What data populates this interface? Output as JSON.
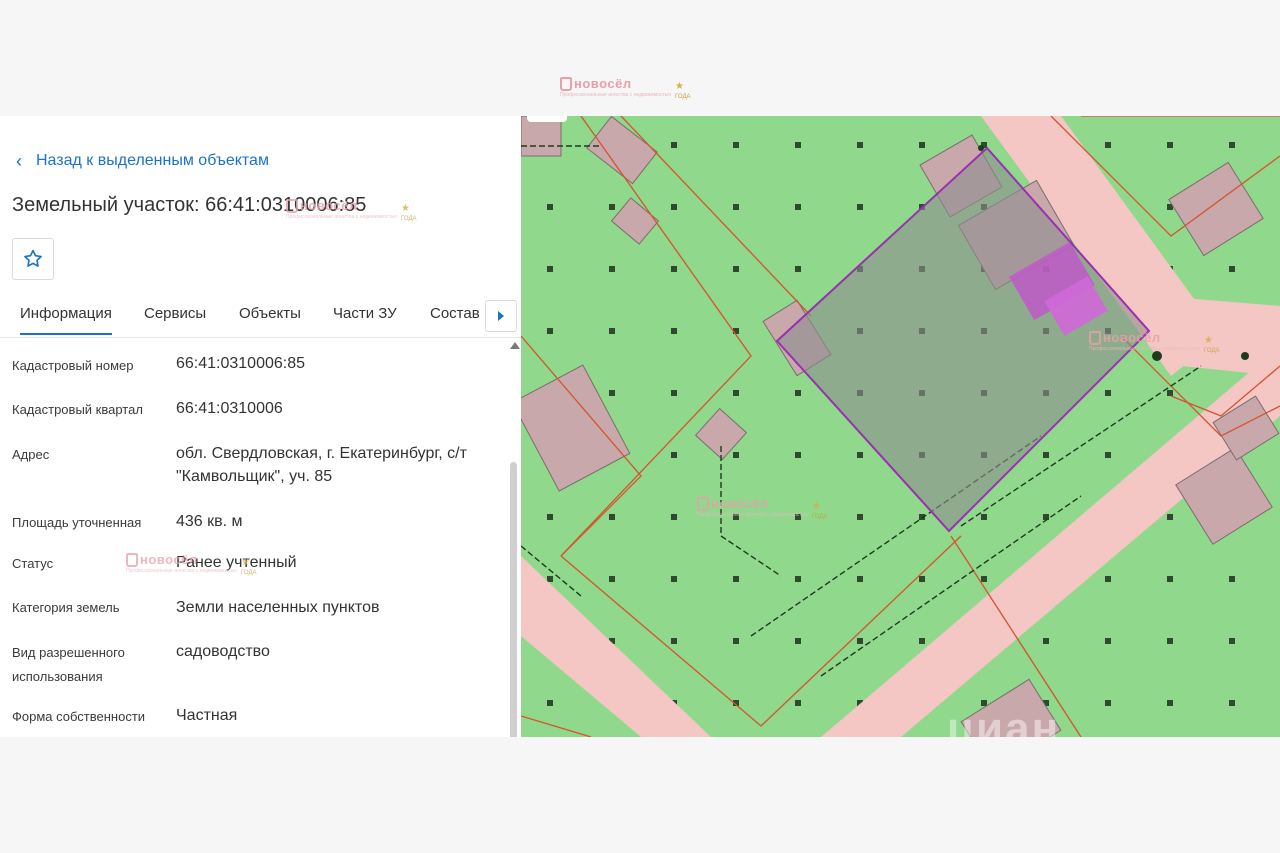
{
  "watermark": {
    "brand": "новосёл",
    "tagline": "Профессиональные агенства с недвижимостью",
    "years": "ГОДА"
  },
  "back_link": {
    "label": "Назад к выделенным объектам"
  },
  "title": "Земельный участок: 66:41:0310006:85",
  "tabs": [
    {
      "label": "Информация",
      "active": true
    },
    {
      "label": "Сервисы"
    },
    {
      "label": "Объекты"
    },
    {
      "label": "Части ЗУ"
    },
    {
      "label": "Состав"
    }
  ],
  "info": [
    {
      "label": "Кадастровый номер",
      "value": "66:41:0310006:85"
    },
    {
      "label": "Кадастровый квартал",
      "value": "66:41:0310006"
    },
    {
      "label": "Адрес",
      "value": "обл. Свердловская, г. Екатеринбург, с/т \"Камвольщик\", уч. 85"
    },
    {
      "label": "Площадь уточненная",
      "value": "436 кв. м"
    },
    {
      "label": "Статус",
      "value": "Ранее учтенный"
    },
    {
      "label": "Категория земель",
      "value": "Земли населенных пунктов"
    },
    {
      "label": "Вид разрешенного использования",
      "value": "садоводство"
    },
    {
      "label": "Форма собственности",
      "value": "Частная"
    }
  ],
  "map": {
    "watermark": "циан"
  },
  "colors": {
    "accent": "#1a73c8",
    "map_green": "#8fd88c",
    "road": "#f4c6c4",
    "parcel_outline": "#9a2fb0",
    "building": "#c9a8ac"
  }
}
